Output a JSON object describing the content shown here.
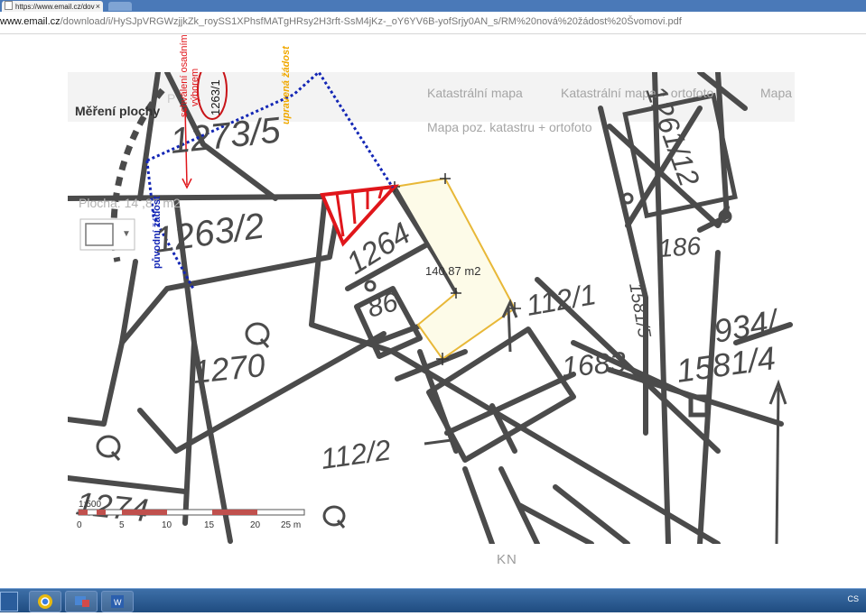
{
  "browser": {
    "tab_title": "https://www.email.cz/dov",
    "tab_close": "×",
    "url_host": "www.email.cz",
    "url_path": "/download/i/HySJpVRGWzjjkZk_roySS1XPhsfMATgHRsy2H3rft-SsM4jKz-_oY6YV6B-yofSrjy0AN_s/RM%20nová%20žádost%20Švomovi.pdf"
  },
  "map": {
    "tool_title": "Měření plochy",
    "tool_title_faded": "P",
    "area_label": "Plocha: 14 ,87 m2",
    "dropdown_caret": "▼",
    "layer_tabs": [
      "Katastrální mapa",
      "Katastrální mapa + ortofoto",
      "Mapa"
    ],
    "layer_tab_row2": "Mapa poz. katastru + ortofoto",
    "measured_area": "140.87 m2",
    "parcels": [
      "1273/5",
      "1263/2",
      "1264",
      "86",
      "112/1",
      "1683",
      "1270",
      "112/2",
      "1274",
      "1261/12",
      "186",
      "1581/5",
      "934/",
      "1581/4"
    ],
    "scale_ratio": "1:500",
    "scale_ticks": [
      "0",
      "5",
      "10",
      "15",
      "20",
      "25 m"
    ]
  },
  "annotations": {
    "approved": "schválení osadním výborem",
    "circled_parcel": "1263/1",
    "modified_request": "upravená žádost",
    "original_request": "původní žádost"
  },
  "footer_label": "KN",
  "taskbar": {
    "tray_text": "CS"
  },
  "colors": {
    "map_line": "#4b4b4b",
    "highlight_red": "#e0161b",
    "orange": "#f0a800",
    "blue_dotted": "#1326b5",
    "measure_yellow": "#e8b838",
    "scale_red": "#c0504d"
  }
}
